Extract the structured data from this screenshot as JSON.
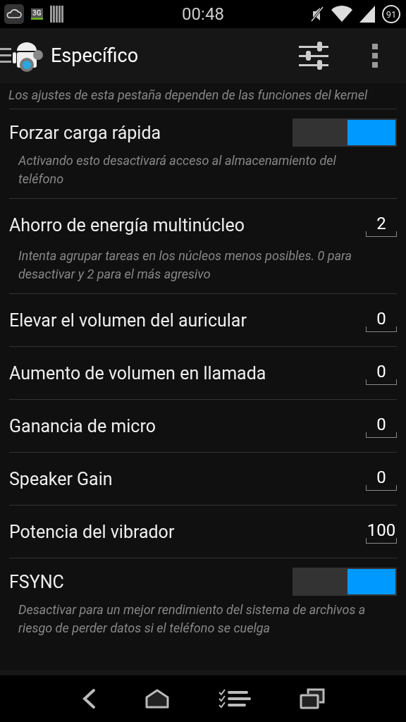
{
  "status_bar": {
    "network": "3G",
    "time": "00:48",
    "battery": "91"
  },
  "action_bar": {
    "title": "Específico"
  },
  "intro": "Los ajustes de esta pestaña dependen de las funciones del kernel",
  "settings": [
    {
      "kind": "switch",
      "title": "Forzar carga rápida",
      "on": true,
      "description": "Activando esto desactivará acceso al almacenamiento del teléfono"
    },
    {
      "kind": "number",
      "title": "Ahorro de energía multinúcleo",
      "value": "2",
      "description": "Intenta agrupar tareas en los núcleos menos posibles. 0 para desactivar y 2 para el más agresivo"
    },
    {
      "kind": "number",
      "title": "Elevar el volumen del auricular",
      "value": "0"
    },
    {
      "kind": "number",
      "title": "Aumento de volumen en llamada",
      "value": "0"
    },
    {
      "kind": "number",
      "title": "Ganancia de micro",
      "value": "0"
    },
    {
      "kind": "number",
      "title": "Speaker Gain",
      "value": "0"
    },
    {
      "kind": "number",
      "title": "Potencia del vibrador",
      "value": "100"
    },
    {
      "kind": "switch",
      "title": "FSYNC",
      "on": true,
      "description": "Desactivar para un mejor rendimiento del sistema de archivos a riesgo de perder datos si el teléfono se cuelga"
    }
  ]
}
